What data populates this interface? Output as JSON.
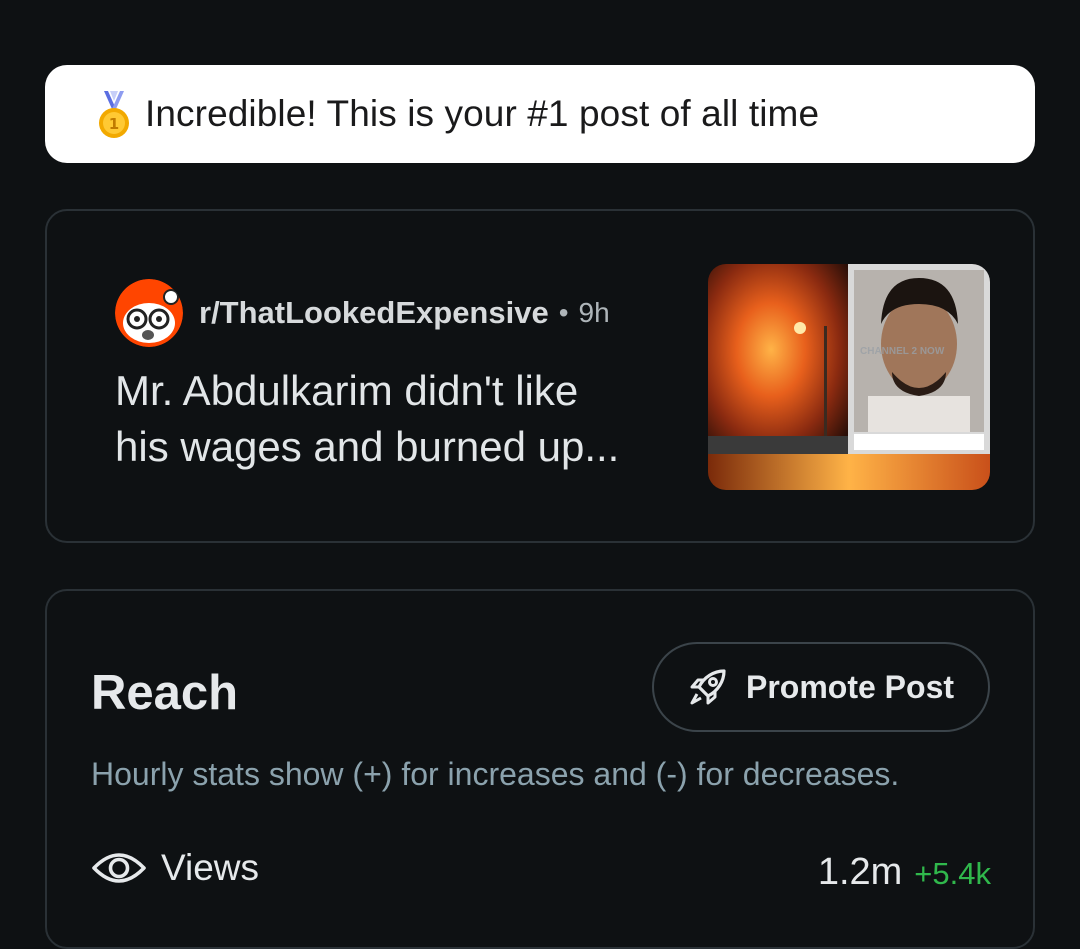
{
  "banner": {
    "icon": "medal-icon",
    "text": "Incredible! This is your #1 post of all time"
  },
  "post": {
    "subreddit": "r/ThatLookedExpensive",
    "separator": "•",
    "age": "9h",
    "title_line1": "Mr. Abdulkarim didn't like",
    "title_line2": "his wages and burned up...",
    "thumbnail_watermark": "CHANNEL 2 NOW"
  },
  "reach": {
    "title": "Reach",
    "promote_label": "Promote Post",
    "hint": "Hourly stats show (+) for increases and (-) for decreases.",
    "views": {
      "label": "Views",
      "value": "1.2m",
      "delta": "+5.4k"
    }
  },
  "colors": {
    "background": "#0e1113",
    "card_border": "#2a3136",
    "delta_green": "#30b84c",
    "hint_text": "#8ba2ad",
    "subreddit_avatar": "#ff4500"
  }
}
